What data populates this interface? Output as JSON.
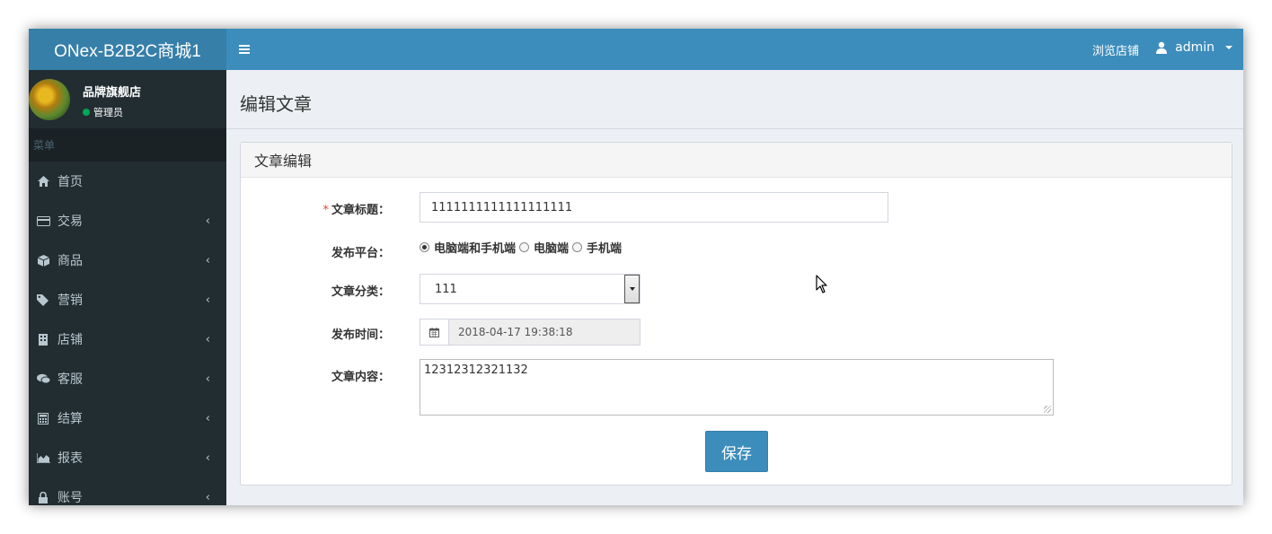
{
  "app": {
    "logo": "ONex-B2B2C商城1"
  },
  "topbar": {
    "browse_shop": "浏览店铺",
    "user": "admin"
  },
  "user_panel": {
    "shop_name": "品牌旗舰店",
    "role": "管理员"
  },
  "sidebar": {
    "header": "菜单",
    "items": [
      {
        "label": "首页",
        "icon": "home-icon"
      },
      {
        "label": "交易",
        "icon": "credit-card-icon"
      },
      {
        "label": "商品",
        "icon": "cube-icon"
      },
      {
        "label": "营销",
        "icon": "tags-icon"
      },
      {
        "label": "店铺",
        "icon": "building-icon"
      },
      {
        "label": "客服",
        "icon": "comments-icon"
      },
      {
        "label": "结算",
        "icon": "calculator-icon"
      },
      {
        "label": "报表",
        "icon": "area-chart-icon"
      },
      {
        "label": "账号",
        "icon": "lock-icon"
      }
    ]
  },
  "page": {
    "title": "编辑文章"
  },
  "form": {
    "box_title": "文章编辑",
    "title_label": "文章标题：",
    "title_value": "1111111111111111111",
    "platform_label": "发布平台：",
    "platform_options": [
      "电脑端和手机端",
      "电脑端",
      "手机端"
    ],
    "platform_selected": "电脑端和手机端",
    "category_label": "文章分类：",
    "category_value": "111",
    "time_label": "发布时间：",
    "time_value": "2018-04-17 19:38:18",
    "content_label": "文章内容：",
    "content_value": "12312312321132",
    "save_label": "保存"
  },
  "colors": {
    "accent": "#3c8dbc",
    "logo_bg": "#367fa9",
    "sidebar_bg": "#222d32",
    "online": "#00a65a"
  }
}
